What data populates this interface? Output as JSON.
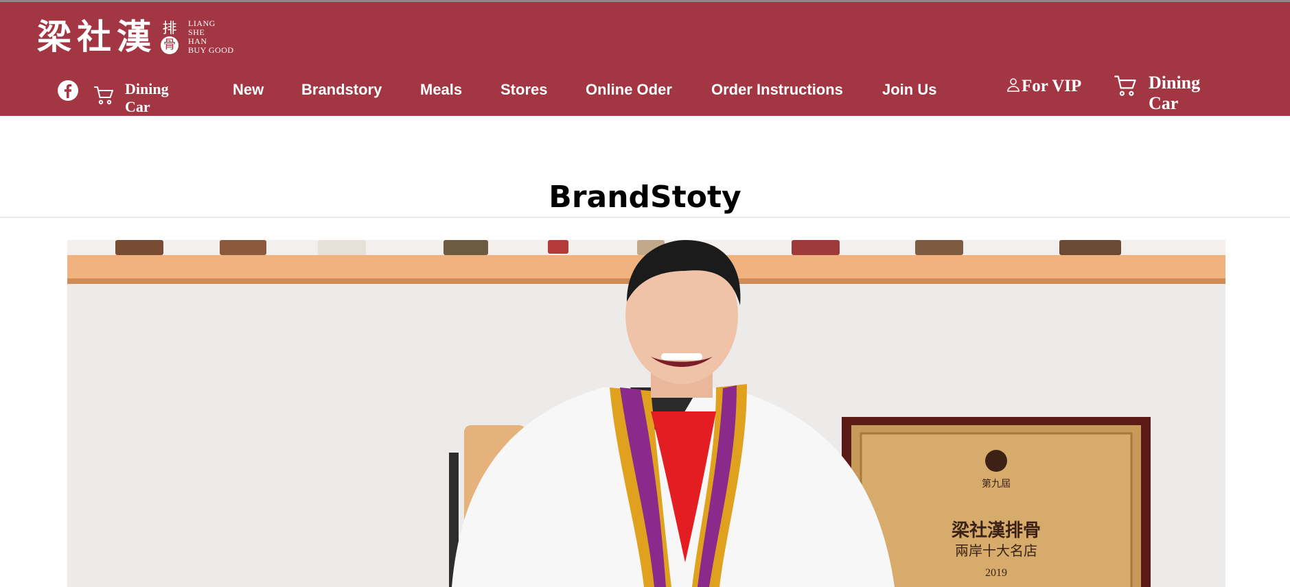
{
  "logo": {
    "cn": "梁社漢",
    "badge_top": "排",
    "badge_bottom": "骨",
    "en_lines": [
      "LIANG",
      "SHE",
      "HAN",
      "BUY GOOD"
    ]
  },
  "header": {
    "dining_car_left": "Dining Car",
    "nav": [
      {
        "label": "New"
      },
      {
        "label": "Brandstory"
      },
      {
        "label": "Meals"
      },
      {
        "label": "Stores"
      },
      {
        "label": "Online Oder"
      },
      {
        "label": "Order Instructions"
      },
      {
        "label": "Join Us"
      }
    ],
    "vip_label": "For VIP",
    "dining_car_right": "Dining Car"
  },
  "page": {
    "title": "BrandStoty"
  },
  "hero": {
    "plaque_line1": "第九屆",
    "plaque_line2": "梁社漢排骨",
    "plaque_line3": "兩岸十大名店",
    "plaque_year": "2019"
  },
  "colors": {
    "brand": "#a33643",
    "white": "#ffffff",
    "divider": "#e9e9e9"
  },
  "icons": {
    "facebook": "facebook-icon",
    "cart": "cart-icon",
    "user": "user-icon"
  }
}
